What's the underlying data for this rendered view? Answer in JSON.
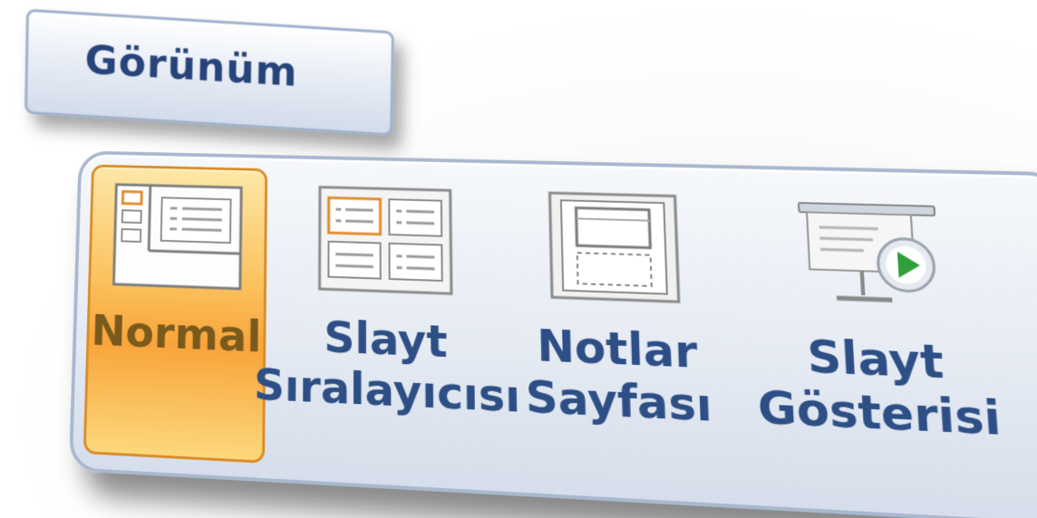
{
  "tab": {
    "label": "Görünüm"
  },
  "buttons": {
    "normal": {
      "line1": "Normal",
      "active": true
    },
    "slide_sorter": {
      "line1": "Slayt",
      "line2": "Sıralayıcısı"
    },
    "notes_page": {
      "line1": "Notlar",
      "line2": "Sayfası"
    },
    "slide_show": {
      "line1": "Slayt",
      "line2": "Gösterisi"
    }
  },
  "colors": {
    "label_text": "#2d4f86",
    "active_button": "#f8a43a",
    "panel_border": "#a9b8cf"
  },
  "icons": {
    "normal": "normal-view-icon",
    "slide_sorter": "slide-sorter-icon",
    "notes_page": "notes-page-icon",
    "slide_show": "slide-show-icon"
  }
}
